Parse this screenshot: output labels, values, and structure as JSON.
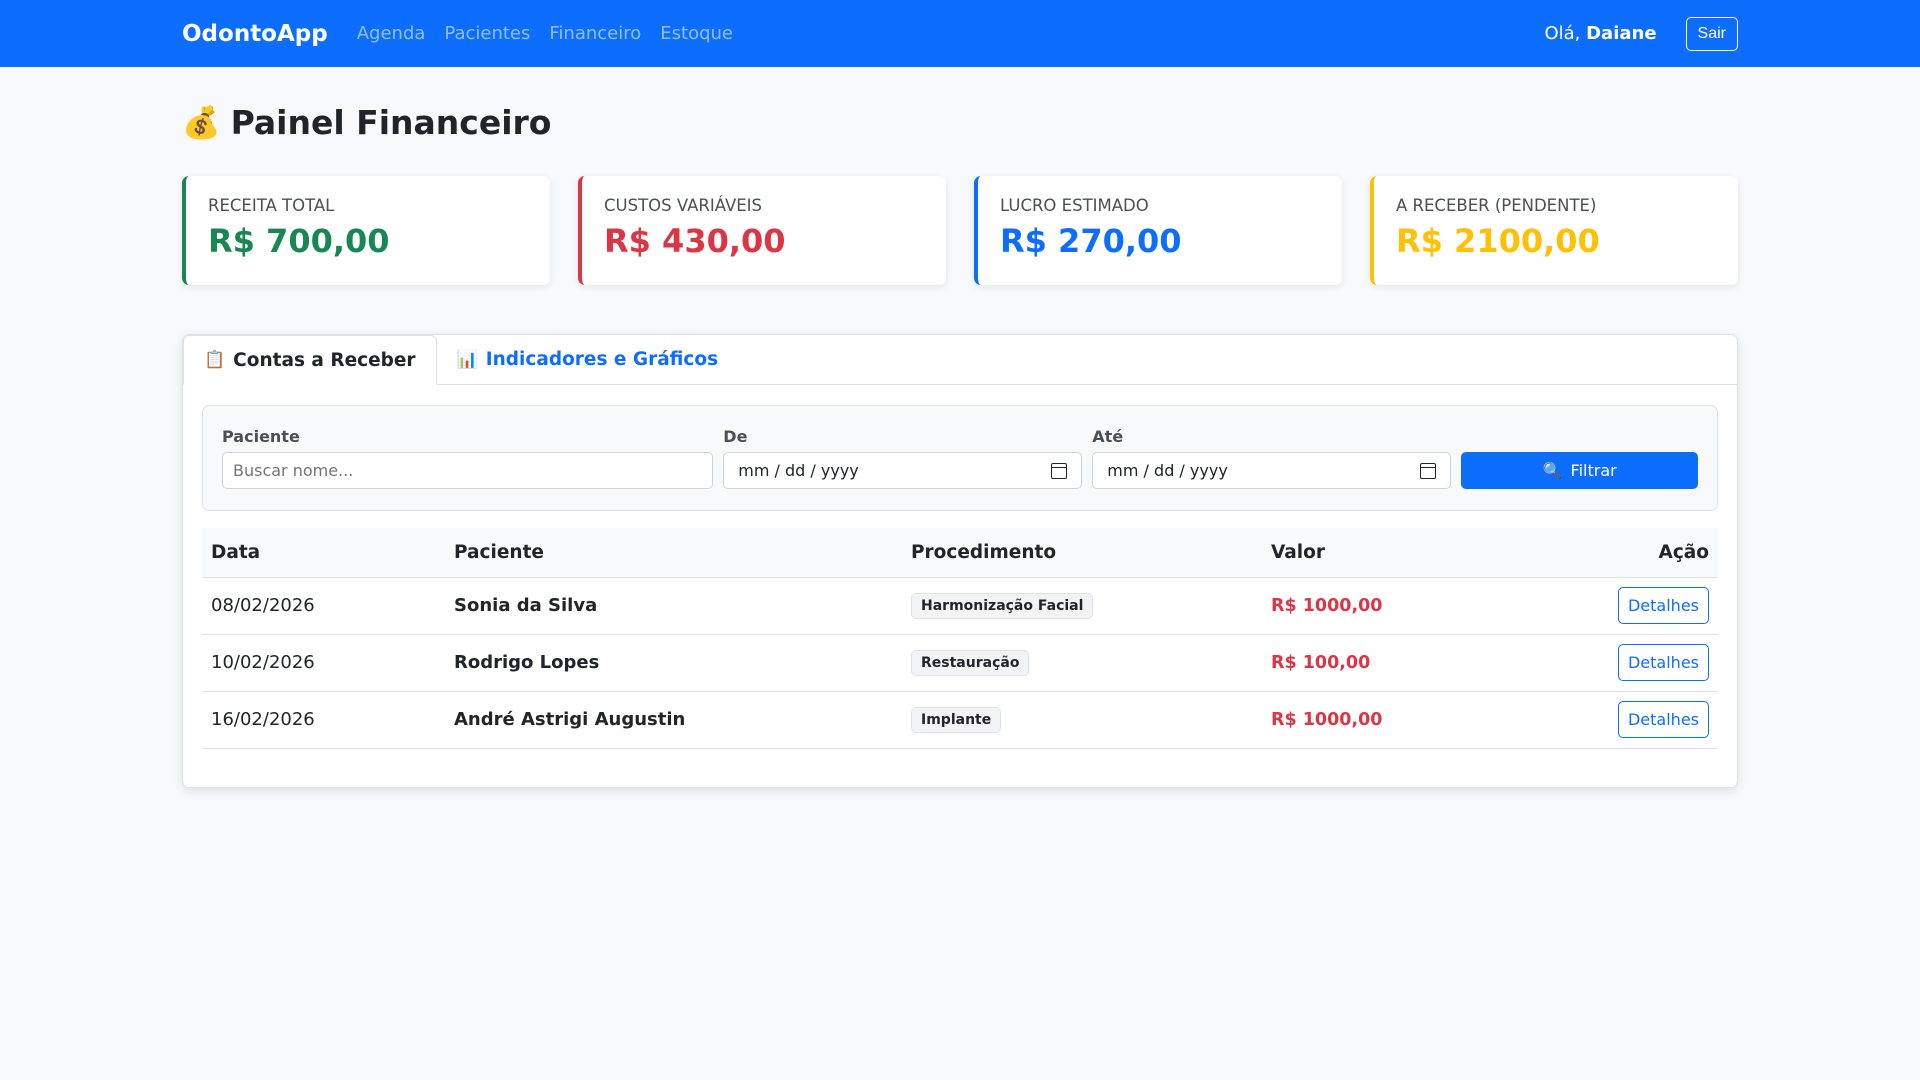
{
  "navbar": {
    "brand": "OdontoApp",
    "links": [
      "Agenda",
      "Pacientes",
      "Financeiro",
      "Estoque"
    ],
    "greeting_prefix": "Olá, ",
    "user_name": "Daiane",
    "logout_label": "Sair"
  },
  "page": {
    "title_emoji": "💰",
    "title": "Painel Financeiro"
  },
  "cards": [
    {
      "label": "Receita Total",
      "value": "R$ 700,00",
      "color": "#198754"
    },
    {
      "label": "Custos Variáveis",
      "value": "R$ 430,00",
      "color": "#dc3545"
    },
    {
      "label": "Lucro Estimado",
      "value": "R$ 270,00",
      "color": "#0d6efd"
    },
    {
      "label": "A Receber (Pendente)",
      "value": "R$ 2100,00",
      "color": "#ffc107"
    }
  ],
  "tabs": [
    {
      "icon": "📋",
      "label": "Contas a Receber"
    },
    {
      "icon": "📊",
      "label": "Indicadores e Gráficos"
    }
  ],
  "filters": {
    "patient_label": "Paciente",
    "patient_placeholder": "Buscar nome...",
    "from_label": "De",
    "from_value": "mm / dd / yyyy",
    "to_label": "Até",
    "to_value": "mm / dd / yyyy",
    "filter_icon": "🔍",
    "filter_label": "Filtrar"
  },
  "table": {
    "headers": [
      "Data",
      "Paciente",
      "Procedimento",
      "Valor",
      "Ação"
    ],
    "rows": [
      {
        "date": "08/02/2026",
        "patient": "Sonia da Silva",
        "procedure": "Harmonização Facial",
        "value": "R$ 1000,00",
        "action": "Detalhes"
      },
      {
        "date": "10/02/2026",
        "patient": "Rodrigo Lopes",
        "procedure": "Restauração",
        "value": "R$ 100,00",
        "action": "Detalhes"
      },
      {
        "date": "16/02/2026",
        "patient": "André Astrigi Augustin",
        "procedure": "Implante",
        "value": "R$ 1000,00",
        "action": "Detalhes"
      }
    ]
  }
}
